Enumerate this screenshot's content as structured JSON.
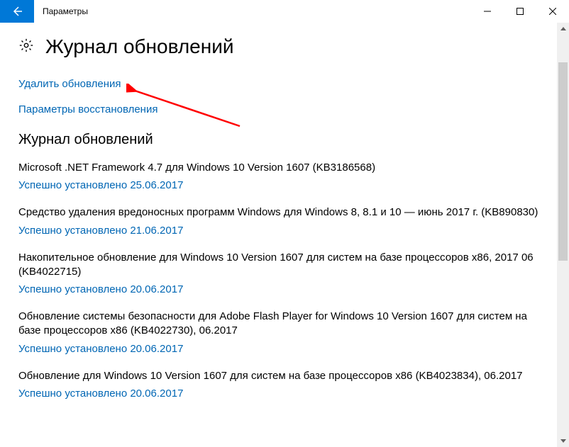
{
  "window": {
    "title": "Параметры"
  },
  "page": {
    "heading": "Журнал обновлений"
  },
  "links": {
    "uninstall": "Удалить обновления",
    "recovery": "Параметры восстановления"
  },
  "section": {
    "title": "Журнал обновлений"
  },
  "updates": [
    {
      "name": "Microsoft .NET Framework 4.7 для Windows 10 Version 1607 (KB3186568)",
      "status": "Успешно установлено 25.06.2017"
    },
    {
      "name": "Средство удаления вредоносных программ Windows для Windows 8, 8.1 и 10 — июнь 2017 г. (KB890830)",
      "status": "Успешно установлено 21.06.2017"
    },
    {
      "name": "Накопительное обновление для Windows 10 Version 1607 для систем на базе процессоров x86, 2017 06 (KB4022715)",
      "status": "Успешно установлено 20.06.2017"
    },
    {
      "name": "Обновление системы безопасности для Adobe Flash Player for Windows 10 Version 1607 для систем на базе процессоров x86 (KB4022730), 06.2017",
      "status": "Успешно установлено 20.06.2017"
    },
    {
      "name": "Обновление для Windows 10 Version 1607 для систем на базе процессоров x86 (KB4023834), 06.2017",
      "status": "Успешно установлено 20.06.2017"
    }
  ]
}
